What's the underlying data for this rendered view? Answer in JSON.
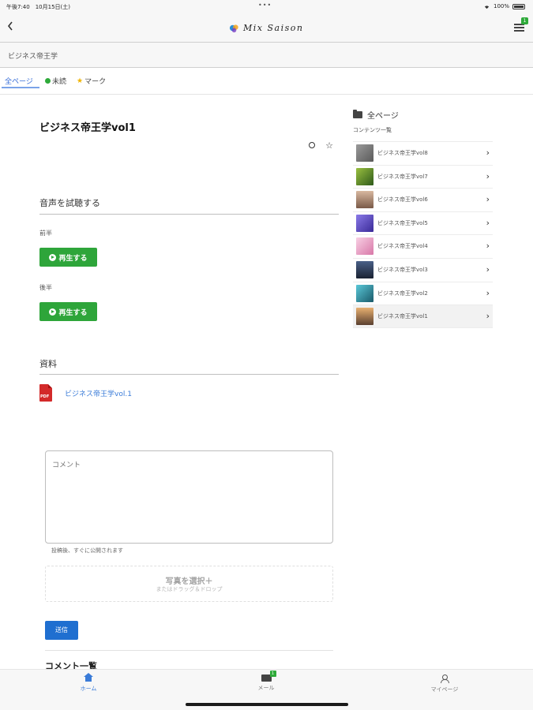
{
  "status_bar": {
    "time": "午後7:40　10月15日(土)",
    "dots": "•••",
    "battery_text": "100%"
  },
  "header": {
    "logo_text": "Mix Saison",
    "back_icon": "chevron-left-icon",
    "menu_icon": "hamburger-menu-icon",
    "menu_badge": "1"
  },
  "breadcrumb": "ビジネス帝王学",
  "tabs": [
    {
      "label": "全ページ"
    },
    {
      "label": "未読"
    },
    {
      "label": "マーク"
    }
  ],
  "main": {
    "title": "ビジネス帝王学vol1",
    "listen_section": "音声を試聴する",
    "first_half_label": "前半",
    "second_half_label": "後半",
    "play_label": "再生する",
    "materials_section": "資料",
    "pdf_icon_text": "PDF",
    "pdf_link": "ビジネス帝王学vol.1",
    "comment_placeholder": "コメント",
    "comment_note": "投稿後、すぐに公開されます",
    "photo_select": "写真を選択＋",
    "photo_drop_hint": "またはドラッグ＆ドロップ",
    "submit_label": "送信",
    "comment_list_title": "コメント一覧"
  },
  "sidebar": {
    "heading": "全ページ",
    "subheading": "コンテンツ一覧",
    "items": [
      {
        "label": "ビジネス帝王学vol8",
        "thumb": "#7d7d7d"
      },
      {
        "label": "ビジネス帝王学vol7",
        "thumb": "#5c8a2e"
      },
      {
        "label": "ビジネス帝王学vol6",
        "thumb": "#b08060"
      },
      {
        "label": "ビジネス帝王学vol5",
        "thumb": "#6a5ac8"
      },
      {
        "label": "ビジネス帝王学vol4",
        "thumb": "#e9a8c8"
      },
      {
        "label": "ビジネス帝王学vol3",
        "thumb": "#2d3a52"
      },
      {
        "label": "ビジネス帝王学vol2",
        "thumb": "#2a8a96"
      },
      {
        "label": "ビジネス帝王学vol1",
        "thumb": "#c08a5a"
      }
    ]
  },
  "bottom_nav": {
    "home": "ホーム",
    "mail": "メール",
    "mail_badge": "1",
    "mypage": "マイページ"
  },
  "colors": {
    "accent_blue": "#3a7bd8",
    "play_green": "#2ea53a",
    "submit_blue": "#1f6fd0",
    "pdf_red": "#d32a2a"
  }
}
